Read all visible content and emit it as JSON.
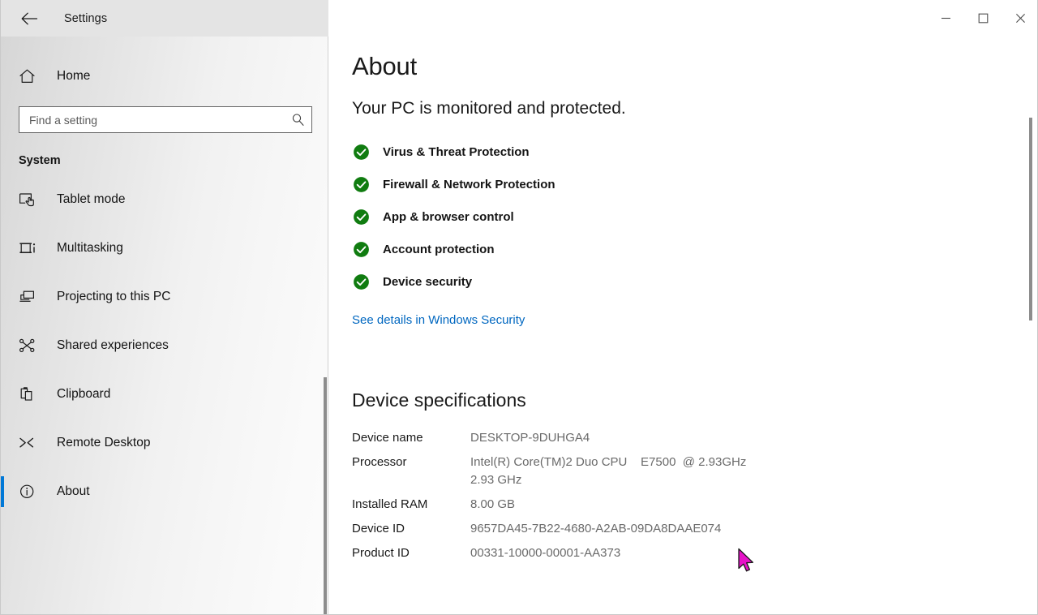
{
  "window": {
    "title": "Settings",
    "back_icon": "back-arrow-icon",
    "minimize_label": "—",
    "maximize_label": "□",
    "close_label": "✕"
  },
  "sidebar": {
    "home": {
      "label": "Home",
      "icon": "home-icon"
    },
    "search": {
      "placeholder": "Find a setting",
      "value": "",
      "icon": "search-icon"
    },
    "group_label": "System",
    "items": [
      {
        "label": "Tablet mode",
        "icon": "tablet-mode-icon",
        "selected": false
      },
      {
        "label": "Multitasking",
        "icon": "multitasking-icon",
        "selected": false
      },
      {
        "label": "Projecting to this PC",
        "icon": "projecting-icon",
        "selected": false
      },
      {
        "label": "Shared experiences",
        "icon": "shared-experiences-icon",
        "selected": false
      },
      {
        "label": "Clipboard",
        "icon": "clipboard-icon",
        "selected": false
      },
      {
        "label": "Remote Desktop",
        "icon": "remote-desktop-icon",
        "selected": false
      },
      {
        "label": "About",
        "icon": "info-icon",
        "selected": true
      }
    ]
  },
  "main": {
    "page_title": "About",
    "protection_headline": "Your PC is monitored and protected.",
    "security_items": [
      {
        "label": "Virus & Threat Protection",
        "icon": "check-circle-icon",
        "status": "ok"
      },
      {
        "label": "Firewall & Network Protection",
        "icon": "check-circle-icon",
        "status": "ok"
      },
      {
        "label": "App & browser control",
        "icon": "check-circle-icon",
        "status": "ok"
      },
      {
        "label": "Account protection",
        "icon": "check-circle-icon",
        "status": "ok"
      },
      {
        "label": "Device security",
        "icon": "check-circle-icon",
        "status": "ok"
      }
    ],
    "security_link": "See details in Windows Security",
    "device_specifications_title": "Device specifications",
    "specs": [
      {
        "key": "Device name",
        "value": "DESKTOP-9DUHGA4"
      },
      {
        "key": "Processor",
        "value": "Intel(R) Core(TM)2 Duo CPU    E7500  @ 2.93GHz\n2.93 GHz"
      },
      {
        "key": "Installed RAM",
        "value": "8.00 GB"
      },
      {
        "key": "Device ID",
        "value": "9657DA45-7B22-4680-A2AB-09DA8DAAE074"
      },
      {
        "key": "Product ID",
        "value": "00331-10000-00001-AA373"
      }
    ]
  },
  "colors": {
    "accent": "#0078d7",
    "link": "#0067c0",
    "status_ok": "#107c10",
    "sidebar_scrollbar": "#8d8d8d",
    "cursor": "#e612c8"
  },
  "scrollbars": {
    "sidebar_thumb_label": "sidebar-scrollbar-thumb",
    "content_thumb_label": "content-scrollbar-thumb"
  }
}
